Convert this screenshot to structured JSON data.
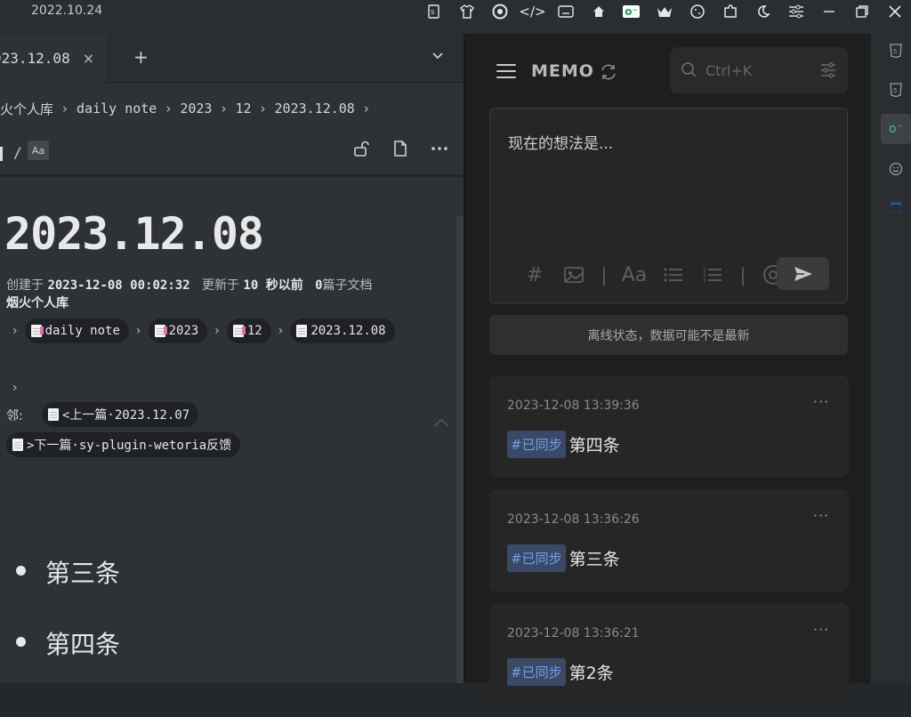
{
  "system": {
    "date": "2022.10.24",
    "icons": [
      "ps-icon",
      "shirt-icon",
      "chrome-icon",
      "code-icon",
      "keyboard-icon",
      "house-icon",
      "memo-plugin-icon",
      "crown-icon",
      "cookie-icon",
      "puzzle-icon",
      "moon-icon",
      "sliders-icon",
      "minimize-icon",
      "restore-icon",
      "close-icon"
    ]
  },
  "editor": {
    "tab": {
      "title": "023.12.08",
      "close": "×"
    },
    "tab_add": "+",
    "breadcrumb": [
      "火个人库",
      "daily note",
      "2023",
      "12",
      "2023.12.08"
    ],
    "toolbar": {
      "slash": "/",
      "aa": "Aa"
    },
    "doc_title": "2023.12.08",
    "meta": {
      "created_label": "创建于",
      "created_value": "2023-12-08 00:02:32",
      "updated_label": "更新于",
      "updated_value": "10 秒以前",
      "children_count": "0",
      "children_label": "篇子文档"
    },
    "notebook": "烟火个人库",
    "path_chips": [
      "daily note",
      "2023",
      "12",
      "2023.12.08"
    ],
    "neighbors_label": "邻:",
    "prev_doc": "<上一篇·2023.12.07",
    "next_doc": ">下一篇·sy-plugin-wetoria反馈",
    "bullets": [
      "第三条",
      "第四条"
    ]
  },
  "memo": {
    "title": "MEMO",
    "search_placeholder": "Ctrl+K",
    "composer_placeholder": "现在的想法是...",
    "composer_tools": {
      "hash": "#",
      "font": "Aa",
      "sep": "|"
    },
    "offline_notice": "离线状态，数据可能不是最新",
    "cards": [
      {
        "time": "2023-12-08 13:39:36",
        "tag": "#已同步",
        "text": "第四条"
      },
      {
        "time": "2023-12-08 13:36:26",
        "tag": "#已同步",
        "text": "第三条"
      },
      {
        "time": "2023-12-08 13:36:21",
        "tag": "#已同步",
        "text": "第2条"
      }
    ],
    "more": "···"
  },
  "colors": {
    "accent_green": "#3ec27a",
    "tag_bg": "#3a4a66",
    "tag_text": "#6ea0e8"
  }
}
